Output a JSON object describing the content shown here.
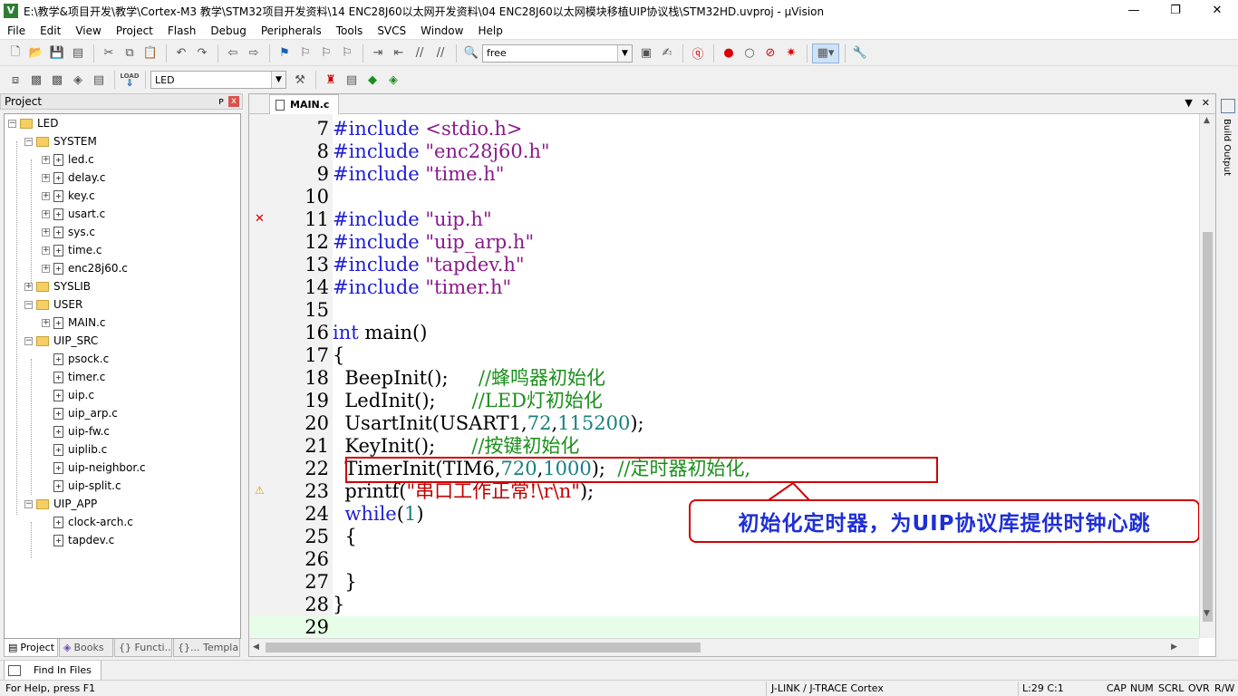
{
  "window": {
    "title": "E:\\教学&项目开发\\教学\\Cortex-M3 教学\\STM32项目开发资料\\14 ENC28J60以太网开发资料\\04 ENC28J60以太网模块移植UIP协议栈\\STM32HD.uvproj - µVision",
    "app_icon": "V",
    "minimize": "—",
    "restore": "❐",
    "close": "✕"
  },
  "menu": [
    "File",
    "Edit",
    "View",
    "Project",
    "Flash",
    "Debug",
    "Peripherals",
    "Tools",
    "SVCS",
    "Window",
    "Help"
  ],
  "toolbar1": {
    "find_combo": "free"
  },
  "toolbar2": {
    "target_combo": "LED",
    "load_label": "LOAD"
  },
  "project_panel": {
    "title": "Project",
    "pin": "ᴘ",
    "close": "x",
    "tree": [
      {
        "label": "LED",
        "type": "root"
      },
      {
        "label": "SYSTEM",
        "type": "group"
      },
      {
        "label": "led.c",
        "type": "file"
      },
      {
        "label": "delay.c",
        "type": "file"
      },
      {
        "label": "key.c",
        "type": "file"
      },
      {
        "label": "usart.c",
        "type": "file"
      },
      {
        "label": "sys.c",
        "type": "file"
      },
      {
        "label": "time.c",
        "type": "file"
      },
      {
        "label": "enc28j60.c",
        "type": "file"
      },
      {
        "label": "SYSLIB",
        "type": "group"
      },
      {
        "label": "USER",
        "type": "group"
      },
      {
        "label": "MAIN.c",
        "type": "file"
      },
      {
        "label": "UIP_SRC",
        "type": "group"
      },
      {
        "label": "psock.c",
        "type": "file"
      },
      {
        "label": "timer.c",
        "type": "file"
      },
      {
        "label": "uip.c",
        "type": "file"
      },
      {
        "label": "uip_arp.c",
        "type": "file"
      },
      {
        "label": "uip-fw.c",
        "type": "file"
      },
      {
        "label": "uiplib.c",
        "type": "file"
      },
      {
        "label": "uip-neighbor.c",
        "type": "file"
      },
      {
        "label": "uip-split.c",
        "type": "file"
      },
      {
        "label": "UIP_APP",
        "type": "group"
      },
      {
        "label": "clock-arch.c",
        "type": "file"
      },
      {
        "label": "tapdev.c",
        "type": "file"
      }
    ],
    "tabs": [
      "Project",
      "Books",
      "{} Functi...",
      "{}... Templa..."
    ]
  },
  "editor": {
    "tab": "MAIN.c",
    "lines": [
      {
        "n": "7",
        "t": "#include <stdio.h>"
      },
      {
        "n": "8",
        "t": "#include \"enc28j60.h\""
      },
      {
        "n": "9",
        "t": "#include \"time.h\""
      },
      {
        "n": "10",
        "t": ""
      },
      {
        "n": "11",
        "t": "#include \"uip.h\""
      },
      {
        "n": "12",
        "t": "#include \"uip_arp.h\""
      },
      {
        "n": "13",
        "t": "#include \"tapdev.h\""
      },
      {
        "n": "14",
        "t": "#include \"timer.h\""
      },
      {
        "n": "15",
        "t": ""
      },
      {
        "n": "16",
        "t": "int main()"
      },
      {
        "n": "17",
        "t": "{"
      },
      {
        "n": "18",
        "t": "  BeepInit();     //蜂鸣器初始化"
      },
      {
        "n": "19",
        "t": "  LedInit();      //LED灯初始化"
      },
      {
        "n": "20",
        "t": "  UsartInit(USART1,72,115200);"
      },
      {
        "n": "21",
        "t": "  KeyInit();      //按键初始化"
      },
      {
        "n": "22",
        "t": "  TimerInit(TIM6,720,1000);  //定时器初始化,"
      },
      {
        "n": "23",
        "t": "  printf(\"串口工作正常!\\r\\n\");"
      },
      {
        "n": "24",
        "t": "  while(1)"
      },
      {
        "n": "25",
        "t": "  {"
      },
      {
        "n": "26",
        "t": ""
      },
      {
        "n": "27",
        "t": "  }"
      },
      {
        "n": "28",
        "t": "}"
      },
      {
        "n": "29",
        "t": ""
      }
    ],
    "error_marker": "✕",
    "warning_marker": "⚠",
    "callout": "初始化定时器，为UIP协议库提供时钟心跳"
  },
  "sidebar": {
    "label": "Build Output"
  },
  "find_tab": "Find In Files",
  "status": {
    "help": "For Help, press F1",
    "debugger": "J-LINK / J-TRACE Cortex",
    "cursor": "L:29 C:1",
    "caps": "CAP",
    "num": "NUM",
    "scrl": "SCRL",
    "ovr": "OVR",
    "rw": "R/W"
  },
  "colors": {
    "keyword": "#1f1fd6",
    "comment": "#1b8f1b",
    "annotation": "#d00000",
    "callout_text": "#1e2fd6"
  }
}
